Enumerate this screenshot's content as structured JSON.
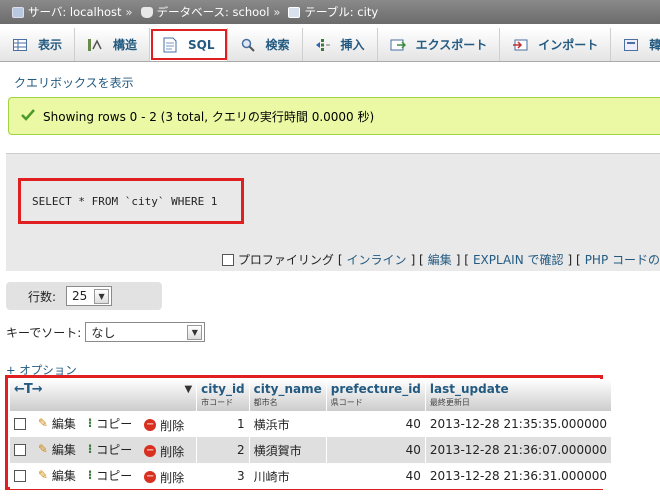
{
  "breadcrumb": {
    "server": "サーバ: localhost",
    "database": "データベース: school",
    "table": "テーブル: city",
    "separator": "»"
  },
  "tabs": [
    {
      "label": "表示",
      "icon": "table-icon"
    },
    {
      "label": "構造",
      "icon": "structure-icon"
    },
    {
      "label": "SQL",
      "icon": "sql-icon"
    },
    {
      "label": "検索",
      "icon": "search-icon"
    },
    {
      "label": "挿入",
      "icon": "insert-icon"
    },
    {
      "label": "エクスポート",
      "icon": "export-icon"
    },
    {
      "label": "インポート",
      "icon": "import-icon"
    },
    {
      "label": "韓",
      "icon": "operations-icon"
    }
  ],
  "querybox_link": "クエリボックスを表示",
  "success_message": "Showing rows 0 - 2 (3 total, クエリの実行時間 0.0000 秒)",
  "sql_query": "SELECT * FROM `city` WHERE 1",
  "sql_links": {
    "profiling": "プロファイリング",
    "inline": "インライン",
    "edit": "編集",
    "explain": "EXPLAIN で確認",
    "php_code": "PHP コードの"
  },
  "rows_label": "行数:",
  "rows_value": "25",
  "sort_label": "キーでソート:",
  "sort_value": "なし",
  "options_link": "+ オプション",
  "table": {
    "columns": [
      {
        "name": "city_id",
        "comment": "市コード"
      },
      {
        "name": "city_name",
        "comment": "都市名"
      },
      {
        "name": "prefecture_id",
        "comment": "県コード"
      },
      {
        "name": "last_update",
        "comment": "最終更新日"
      }
    ],
    "actions": {
      "edit": "編集",
      "copy": "コピー",
      "delete": "削除"
    },
    "rows": [
      {
        "city_id": "1",
        "city_name": "横浜市",
        "prefecture_id": "40",
        "last_update": "2013-12-28 21:35:35.000000"
      },
      {
        "city_id": "2",
        "city_name": "横須賀市",
        "prefecture_id": "40",
        "last_update": "2013-12-28 21:36:07.000000"
      },
      {
        "city_id": "3",
        "city_name": "川崎市",
        "prefecture_id": "40",
        "last_update": "2013-12-28 21:36:31.000000"
      }
    ]
  },
  "colors": {
    "highlight_red": "#e02020",
    "link_blue": "#235a81",
    "success_bg": "#ebf8a4"
  }
}
